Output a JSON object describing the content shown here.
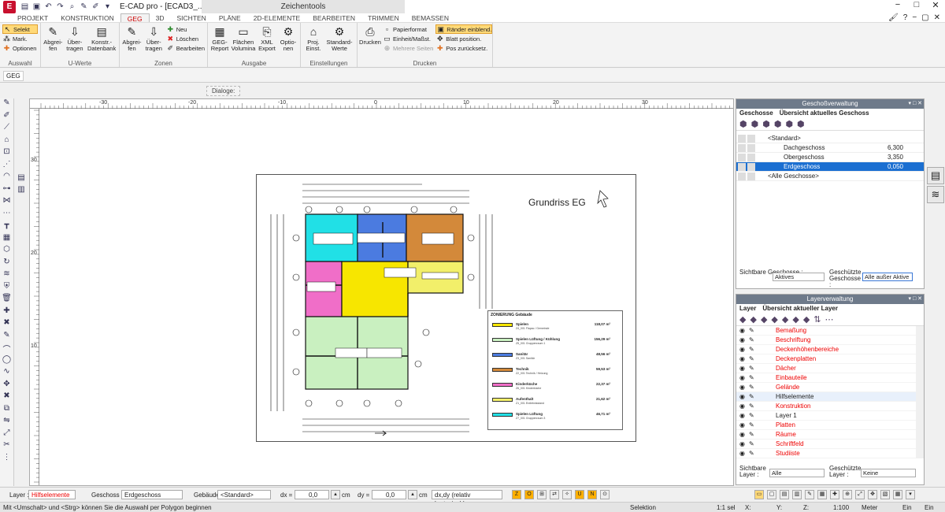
{
  "window": {
    "title": "E-CAD pro - [ECAD3_...",
    "context_tab": "Zeichentools",
    "controls": [
      "−",
      "□",
      "✕"
    ]
  },
  "tabs": [
    "PROJEKT",
    "KONSTRUKTION",
    "GEG",
    "3D",
    "SICHTEN",
    "PLÄNE",
    "2D-ELEMENTE",
    "BEARBEITEN",
    "TRIMMEN",
    "BEMASSEN"
  ],
  "active_tab": "GEG",
  "ribbon": {
    "auswahl": {
      "label": "Auswahl",
      "selekt": "Selekt",
      "mark": "Mark.",
      "optionen": "Optionen"
    },
    "uwerte": {
      "label": "U-Werte",
      "abgreifen": "Abgrei-fen",
      "uebertragen": "Über-tragen",
      "datenbank": "Konstr.-Datenbank"
    },
    "zonen": {
      "label": "Zonen",
      "abgreifen": "Abgrei-fen",
      "uebertragen": "Über-tragen",
      "neu": "Neu",
      "loeschen": "Löschen",
      "bearbeiten": "Bearbeiten"
    },
    "ausgabe": {
      "label": "Ausgabe",
      "report": "GEG-Report",
      "flaechen": "Flächen Volumina",
      "xml": "XML Export",
      "optionen": "Optio-nen"
    },
    "einstellungen": {
      "label": "Einstellungen",
      "proj": "Proj. Einst.",
      "standard": "Standard-Werte"
    },
    "drucken": {
      "label": "Drucken",
      "drucken": "Drucken",
      "papierformat": "Papierformat",
      "einheit": "Einheit/Maßst.",
      "mehrere": "Mehrere Seiten",
      "raender": "Ränder einblend.",
      "blatt": "Blatt position.",
      "pos": "Pos zurücksetz."
    }
  },
  "sub_label": "GEG",
  "dialoge": "Dialoge:",
  "ruler": {
    "h": [
      "-30",
      "-20",
      "-10",
      "0",
      "10",
      "20",
      "30"
    ],
    "v": [
      "30",
      "20",
      "10"
    ]
  },
  "sheet": {
    "title": "Grundriss EG"
  },
  "legend": {
    "title": "ZONIERUNG Gebäude",
    "items": [
      {
        "name": "Spielen",
        "area": "118,07 m²",
        "color": "#f7e600",
        "sub": "Z4_001 Flapac / Gemeinde"
      },
      {
        "name": "Spielen Lüftung / Kühlung",
        "area": "156,29 m²",
        "color": "#c9f0c0",
        "sub": "Z5_001 Gruppenraum 1"
      },
      {
        "name": "Sanitär",
        "area": "48,56 m²",
        "color": "#4b7be0",
        "sub": "Z3_001 Sanitär"
      },
      {
        "name": "Technik",
        "area": "59,53 m²",
        "color": "#d3893a",
        "sub": "Z2_001 Technik / Heizung"
      },
      {
        "name": "Kinderküche",
        "area": "22,37 m²",
        "color": "#f06ec8",
        "sub": "Z6_001 Kinderküche"
      },
      {
        "name": "Aufenthalt",
        "area": "21,62 m²",
        "color": "#f2ef6a",
        "sub": "Z1_001 Erdlebnisstand"
      },
      {
        "name": "Spielen Lüftung",
        "area": "46,71 m²",
        "color": "#21e0e6",
        "sub": "Z7_001 Gruppenraum 3"
      }
    ]
  },
  "geschoss_panel": {
    "title": "Geschoßverwaltung",
    "tab1": "Geschosse",
    "tab2": "Übersicht aktuelles Geschoss",
    "rows": [
      {
        "name": "<Standard>",
        "value": "",
        "indent": 1
      },
      {
        "name": "Dachgeschoss",
        "value": "6,300",
        "indent": 2
      },
      {
        "name": "Obergeschoss",
        "value": "3,350",
        "indent": 2
      },
      {
        "name": "Erdgeschoss",
        "value": "0,050",
        "indent": 2,
        "hl": true
      },
      {
        "name": "<Alle Geschosse>",
        "value": "",
        "indent": 1
      }
    ],
    "sichtbar_label": "Sichtbare Geschosse :",
    "sichtbar_value": "Aktives",
    "geschuetzt_label": "Geschützte Geschosse :",
    "geschuetzt_value": "Alle außer Aktive"
  },
  "layer_panel": {
    "title": "Layerverwaltung",
    "tab1": "Layer",
    "tab2": "Übersicht aktueller Layer",
    "rows": [
      {
        "name": "Bemaßung",
        "red": true
      },
      {
        "name": "Beschriftung",
        "red": true
      },
      {
        "name": "Deckenhöhenbereiche",
        "red": true
      },
      {
        "name": "Deckenplatten",
        "red": true
      },
      {
        "name": "Dächer",
        "red": true
      },
      {
        "name": "Einbauteile",
        "red": true
      },
      {
        "name": "Gelände",
        "red": true
      },
      {
        "name": "Hilfselemente",
        "red": false,
        "hl": true
      },
      {
        "name": "Konstruktion",
        "red": true
      },
      {
        "name": "Layer 1",
        "red": false
      },
      {
        "name": "Platten",
        "red": true
      },
      {
        "name": "Räume",
        "red": true
      },
      {
        "name": "Schriftfeld",
        "red": true
      },
      {
        "name": "Studiiste",
        "red": true
      }
    ],
    "sichtbar_label": "Sichtbare Layer :",
    "sichtbar_value": "Alle",
    "geschuetzt_label": "Geschützte Layer :",
    "geschuetzt_value": "Keine"
  },
  "statusbar": {
    "layer_label": "Layer :",
    "layer_value": "Hilfselemente",
    "geschoss_label": "Geschoss :",
    "geschoss_value": "Erdgeschoss",
    "gebaeude_label": "Gebäude :",
    "gebaeude_value": "<Standard>",
    "dx_label": "dx =",
    "dx_value": "0,0",
    "dy_label": "dy =",
    "dy_value": "0,0",
    "unit": "cm",
    "mode": "dx,dy (relativ kartesisch)"
  },
  "bottombar": {
    "hint": "Mit <Umschalt> und <Strg> können Sie die Auswahl per Polygon beginnen",
    "selektion": "Selektion",
    "scale1": "1:1 sel",
    "x": "X:",
    "y": "Y:",
    "z": "Z:",
    "scale2": "1:100",
    "unit": "Meter",
    "ein1": "Ein",
    "ein2": "Ein"
  }
}
